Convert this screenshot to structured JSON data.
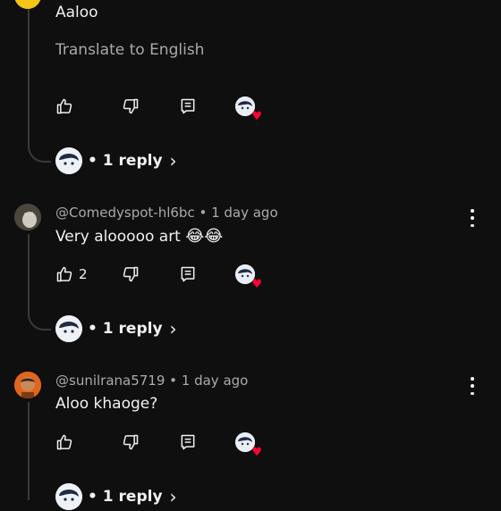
{
  "colors": {
    "background": "#0f0f0f",
    "text": "#f1f1f1",
    "meta": "#aaaaaa",
    "heart": "#ff0033",
    "line": "#3a3a3a"
  },
  "comment1": {
    "body": "Aaloo",
    "translate": "Translate to English",
    "reply_label": "• 1 reply",
    "reply_chevron": "›"
  },
  "comment2": {
    "handle": "@Comedyspot-hl6bc • 1 day ago",
    "body": "Very alooooo art",
    "emojis": "😂😂",
    "likes": "2",
    "reply_label": "• 1 reply",
    "reply_chevron": "›"
  },
  "comment3": {
    "handle": "@sunilrana5719 • 1 day ago",
    "body": "Aloo khaoge?",
    "reply_label": "• 1 reply",
    "reply_chevron": "›"
  },
  "icons": {
    "like": "thumbs-up-icon",
    "dislike": "thumbs-down-icon",
    "reply": "comment-reply-icon",
    "more": "more-vertical-icon",
    "heart": "heart-icon"
  },
  "heart_glyph": "♥"
}
